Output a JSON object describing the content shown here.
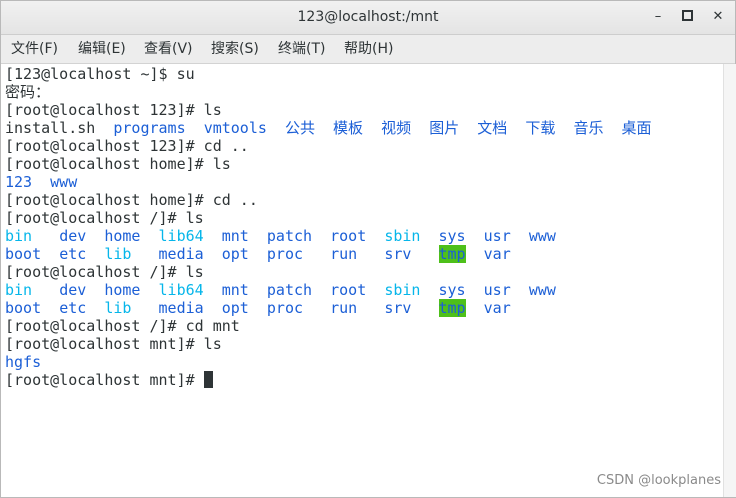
{
  "window": {
    "title": "123@localhost:/mnt",
    "minimize": "–",
    "close": "✕"
  },
  "menu": [
    "文件(F)",
    "编辑(E)",
    "查看(V)",
    "搜索(S)",
    "终端(T)",
    "帮助(H)"
  ],
  "terminal": {
    "lines": [
      {
        "segments": [
          {
            "t": "[123@localhost ~]$ su",
            "c": ""
          }
        ]
      },
      {
        "segments": [
          {
            "t": "密码：",
            "c": ""
          }
        ]
      },
      {
        "segments": [
          {
            "t": "[root@localhost 123]# ls",
            "c": ""
          }
        ]
      },
      {
        "segments": [
          {
            "t": "install.sh  ",
            "c": ""
          },
          {
            "t": "programs",
            "c": "dir"
          },
          {
            "t": "  ",
            "c": ""
          },
          {
            "t": "vmtools",
            "c": "dir"
          },
          {
            "t": "  ",
            "c": ""
          },
          {
            "t": "公共",
            "c": "dir"
          },
          {
            "t": "  ",
            "c": ""
          },
          {
            "t": "模板",
            "c": "dir"
          },
          {
            "t": "  ",
            "c": ""
          },
          {
            "t": "视频",
            "c": "dir"
          },
          {
            "t": "  ",
            "c": ""
          },
          {
            "t": "图片",
            "c": "dir"
          },
          {
            "t": "  ",
            "c": ""
          },
          {
            "t": "文档",
            "c": "dir"
          },
          {
            "t": "  ",
            "c": ""
          },
          {
            "t": "下载",
            "c": "dir"
          },
          {
            "t": "  ",
            "c": ""
          },
          {
            "t": "音乐",
            "c": "dir"
          },
          {
            "t": "  ",
            "c": ""
          },
          {
            "t": "桌面",
            "c": "dir"
          }
        ]
      },
      {
        "segments": [
          {
            "t": "[root@localhost 123]# cd ..",
            "c": ""
          }
        ]
      },
      {
        "segments": [
          {
            "t": "[root@localhost home]# ls",
            "c": ""
          }
        ]
      },
      {
        "segments": [
          {
            "t": "123",
            "c": "dir"
          },
          {
            "t": "  ",
            "c": ""
          },
          {
            "t": "www",
            "c": "dir"
          }
        ]
      },
      {
        "segments": [
          {
            "t": "[root@localhost home]# cd ..",
            "c": ""
          }
        ]
      },
      {
        "segments": [
          {
            "t": "[root@localhost /]# ls",
            "c": ""
          }
        ]
      },
      {
        "segments": [
          {
            "t": "bin",
            "c": "cy"
          },
          {
            "t": "   ",
            "c": ""
          },
          {
            "t": "dev",
            "c": "dir"
          },
          {
            "t": "  ",
            "c": ""
          },
          {
            "t": "home",
            "c": "dir"
          },
          {
            "t": "  ",
            "c": ""
          },
          {
            "t": "lib64",
            "c": "cy"
          },
          {
            "t": "  ",
            "c": ""
          },
          {
            "t": "mnt",
            "c": "dir"
          },
          {
            "t": "  ",
            "c": ""
          },
          {
            "t": "patch",
            "c": "dir"
          },
          {
            "t": "  ",
            "c": ""
          },
          {
            "t": "root",
            "c": "dir"
          },
          {
            "t": "  ",
            "c": ""
          },
          {
            "t": "sbin",
            "c": "cy"
          },
          {
            "t": "  ",
            "c": ""
          },
          {
            "t": "sys",
            "c": "dir"
          },
          {
            "t": "  ",
            "c": ""
          },
          {
            "t": "usr",
            "c": "dir"
          },
          {
            "t": "  ",
            "c": ""
          },
          {
            "t": "www",
            "c": "dir"
          }
        ]
      },
      {
        "segments": [
          {
            "t": "boot",
            "c": "dir"
          },
          {
            "t": "  ",
            "c": ""
          },
          {
            "t": "etc",
            "c": "dir"
          },
          {
            "t": "  ",
            "c": ""
          },
          {
            "t": "lib",
            "c": "cy"
          },
          {
            "t": "   ",
            "c": ""
          },
          {
            "t": "media",
            "c": "dir"
          },
          {
            "t": "  ",
            "c": ""
          },
          {
            "t": "opt",
            "c": "dir"
          },
          {
            "t": "  ",
            "c": ""
          },
          {
            "t": "proc",
            "c": "dir"
          },
          {
            "t": "   ",
            "c": ""
          },
          {
            "t": "run",
            "c": "dir"
          },
          {
            "t": "   ",
            "c": ""
          },
          {
            "t": "srv",
            "c": "dir"
          },
          {
            "t": "   ",
            "c": ""
          },
          {
            "t": "tmp",
            "c": "tmp"
          },
          {
            "t": "  ",
            "c": ""
          },
          {
            "t": "var",
            "c": "dir"
          }
        ]
      },
      {
        "segments": [
          {
            "t": "[root@localhost /]# ls",
            "c": ""
          }
        ]
      },
      {
        "segments": [
          {
            "t": "bin",
            "c": "cy"
          },
          {
            "t": "   ",
            "c": ""
          },
          {
            "t": "dev",
            "c": "dir"
          },
          {
            "t": "  ",
            "c": ""
          },
          {
            "t": "home",
            "c": "dir"
          },
          {
            "t": "  ",
            "c": ""
          },
          {
            "t": "lib64",
            "c": "cy"
          },
          {
            "t": "  ",
            "c": ""
          },
          {
            "t": "mnt",
            "c": "dir"
          },
          {
            "t": "  ",
            "c": ""
          },
          {
            "t": "patch",
            "c": "dir"
          },
          {
            "t": "  ",
            "c": ""
          },
          {
            "t": "root",
            "c": "dir"
          },
          {
            "t": "  ",
            "c": ""
          },
          {
            "t": "sbin",
            "c": "cy"
          },
          {
            "t": "  ",
            "c": ""
          },
          {
            "t": "sys",
            "c": "dir"
          },
          {
            "t": "  ",
            "c": ""
          },
          {
            "t": "usr",
            "c": "dir"
          },
          {
            "t": "  ",
            "c": ""
          },
          {
            "t": "www",
            "c": "dir"
          }
        ]
      },
      {
        "segments": [
          {
            "t": "boot",
            "c": "dir"
          },
          {
            "t": "  ",
            "c": ""
          },
          {
            "t": "etc",
            "c": "dir"
          },
          {
            "t": "  ",
            "c": ""
          },
          {
            "t": "lib",
            "c": "cy"
          },
          {
            "t": "   ",
            "c": ""
          },
          {
            "t": "media",
            "c": "dir"
          },
          {
            "t": "  ",
            "c": ""
          },
          {
            "t": "opt",
            "c": "dir"
          },
          {
            "t": "  ",
            "c": ""
          },
          {
            "t": "proc",
            "c": "dir"
          },
          {
            "t": "   ",
            "c": ""
          },
          {
            "t": "run",
            "c": "dir"
          },
          {
            "t": "   ",
            "c": ""
          },
          {
            "t": "srv",
            "c": "dir"
          },
          {
            "t": "   ",
            "c": ""
          },
          {
            "t": "tmp",
            "c": "tmp"
          },
          {
            "t": "  ",
            "c": ""
          },
          {
            "t": "var",
            "c": "dir"
          }
        ]
      },
      {
        "segments": [
          {
            "t": "[root@localhost /]# cd mnt",
            "c": ""
          }
        ]
      },
      {
        "segments": [
          {
            "t": "[root@localhost mnt]# ls",
            "c": ""
          }
        ]
      },
      {
        "segments": [
          {
            "t": "hgfs",
            "c": "dir"
          }
        ]
      },
      {
        "segments": [
          {
            "t": "[root@localhost mnt]# ",
            "c": ""
          }
        ],
        "cursor": true
      }
    ]
  },
  "colors": {
    "directory": "#1c5fd6",
    "link": "#06b6ea",
    "sticky_dir_bg": "#4ec01a",
    "text": "#2e3436"
  },
  "watermark": "CSDN @lookplanes"
}
